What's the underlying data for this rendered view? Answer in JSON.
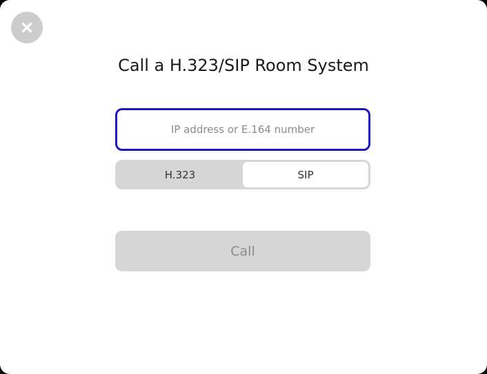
{
  "dialog": {
    "title": "Call a H.323/SIP Room System",
    "close_icon": "close-x-icon"
  },
  "address_input": {
    "value": "",
    "placeholder": "IP address or E.164 number"
  },
  "protocol_toggle": {
    "options": [
      {
        "label": "H.323",
        "selected": false
      },
      {
        "label": "SIP",
        "selected": true
      }
    ]
  },
  "call_button": {
    "label": "Call",
    "enabled": false
  },
  "colors": {
    "focus_border": "#1a16c4",
    "disabled_bg": "#d6d6d6",
    "close_bg": "#cdcdcd"
  }
}
